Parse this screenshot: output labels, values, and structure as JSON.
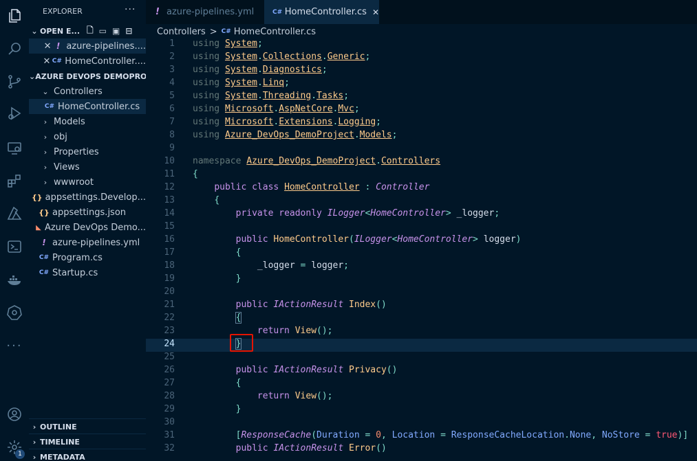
{
  "explorer": {
    "title": "EXPLORER",
    "more": "···",
    "open_editors_label": "OPEN E...",
    "open_editors": [
      {
        "name": "azure-pipelines....",
        "icon": "!"
      },
      {
        "name": "HomeController....",
        "icon": "C#"
      }
    ],
    "project_label": "AZURE DEVOPS DEMOPRO...",
    "tree": [
      {
        "name": "Controllers",
        "type": "folder-open"
      },
      {
        "name": "HomeController.cs",
        "type": "cs-file"
      },
      {
        "name": "Models",
        "type": "folder"
      },
      {
        "name": "obj",
        "type": "folder"
      },
      {
        "name": "Properties",
        "type": "folder"
      },
      {
        "name": "Views",
        "type": "folder"
      },
      {
        "name": "wwwroot",
        "type": "folder"
      },
      {
        "name": "appsettings.Develop...",
        "type": "json-file",
        "icon": "{}"
      },
      {
        "name": "appsettings.json",
        "type": "json-file",
        "icon": "{}"
      },
      {
        "name": "Azure DevOps Demo...",
        "type": "rss-file",
        "icon": "◣"
      },
      {
        "name": "azure-pipelines.yml",
        "type": "yml-file",
        "icon": "!"
      },
      {
        "name": "Program.cs",
        "type": "cs-file"
      },
      {
        "name": "Startup.cs",
        "type": "cs-file"
      }
    ],
    "outline": "OUTLINE",
    "timeline": "TIMELINE",
    "metadata": "METADATA"
  },
  "tabs": [
    {
      "label": "azure-pipelines.yml",
      "icon": "!"
    },
    {
      "label": "HomeController.cs",
      "icon": "C#",
      "close": "✕"
    }
  ],
  "breadcrumb": {
    "folder": "Controllers",
    "sep": ">",
    "file": "HomeController.cs"
  },
  "badge": "1",
  "lines": [
    "1",
    "2",
    "3",
    "4",
    "5",
    "6",
    "7",
    "8",
    "9",
    "10",
    "11",
    "12",
    "13",
    "14",
    "15",
    "16",
    "17",
    "18",
    "19",
    "20",
    "21",
    "22",
    "23",
    "24",
    "25",
    "26",
    "27",
    "28",
    "29",
    "30",
    "31",
    "32"
  ],
  "code": {
    "l1_ns": "System",
    "l2_a": "System",
    "l2_b": "Collections",
    "l2_c": "Generic",
    "l3_a": "System",
    "l3_b": "Diagnostics",
    "l4_a": "System",
    "l4_b": "Linq",
    "l5_a": "System",
    "l5_b": "Threading",
    "l5_c": "Tasks",
    "l6_a": "Microsoft",
    "l6_b": "AspNetCore",
    "l6_c": "Mvc",
    "l7_a": "Microsoft",
    "l7_b": "Extensions",
    "l7_c": "Logging",
    "l8_a": "Azure_DevOps_DemoProject",
    "l8_b": "Models",
    "l10_a": "Azure_DevOps_DemoProject",
    "l10_b": "Controllers",
    "class_name": "HomeController",
    "base_class": "Controller",
    "logger_type": "ILogger",
    "logger_field": "_logger",
    "logger_param": "logger",
    "action_type": "IActionResult",
    "m_index": "Index",
    "m_privacy": "Privacy",
    "m_error": "Error",
    "view_call": "View",
    "attr_name": "ResponseCache",
    "attr_duration": "Duration",
    "attr_duration_val": "0",
    "attr_location": "Location",
    "attr_location_val": "ResponseCacheLocation",
    "attr_location_none": "None",
    "attr_nostore": "NoStore",
    "attr_true": "true"
  },
  "colors": {
    "bg": "#011627",
    "accent": "#1f4a78",
    "highlight_box": "#e51400",
    "line_highlight": "#0b2942"
  }
}
